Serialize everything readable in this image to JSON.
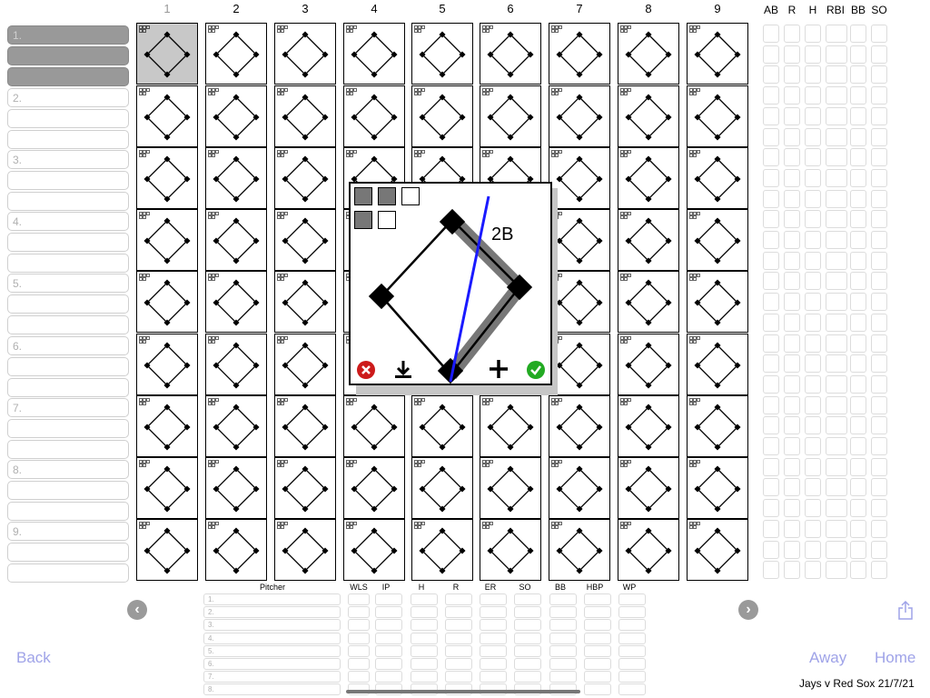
{
  "innings": [
    "1",
    "2",
    "3",
    "4",
    "5",
    "6",
    "7",
    "8",
    "9"
  ],
  "current_inning_index": 0,
  "batters": [
    {
      "number": "1.",
      "active": true
    },
    {
      "number": "2.",
      "active": false
    },
    {
      "number": "3.",
      "active": false
    },
    {
      "number": "4.",
      "active": false
    },
    {
      "number": "5.",
      "active": false
    },
    {
      "number": "6.",
      "active": false
    },
    {
      "number": "7.",
      "active": false
    },
    {
      "number": "8.",
      "active": false
    },
    {
      "number": "9.",
      "active": false
    }
  ],
  "batting_stats_headers": [
    "AB",
    "R",
    "H",
    "RBI",
    "BB",
    "SO"
  ],
  "pitcher_table": {
    "name_header": "Pitcher",
    "stat_headers": [
      "WLS",
      "IP",
      "H",
      "R",
      "ER",
      "SO",
      "BB",
      "HBP",
      "WP"
    ],
    "rows": [
      "1.",
      "2.",
      "3.",
      "4.",
      "5.",
      "6.",
      "7.",
      "8."
    ]
  },
  "popup": {
    "hit_label": "2B",
    "balls_filled": 2,
    "strikes_filled": 1,
    "cancel_icon": "cancel-icon",
    "download_icon": "download-icon",
    "add_icon": "plus-icon",
    "confirm_icon": "confirm-icon"
  },
  "nav": {
    "prev_icon": "chevron-left-icon",
    "next_icon": "chevron-right-icon",
    "back_label": "Back",
    "away_label": "Away",
    "home_label": "Home",
    "share_icon": "share-icon"
  },
  "game_title": "Jays v Red Sox 21/7/21",
  "colors": {
    "active_row": "#999999",
    "active_cell": "#c8c8c8",
    "link": "#9fa3e8",
    "hit_line": "#1a1aff",
    "cancel": "#cc1a1a",
    "confirm": "#22aa22"
  }
}
